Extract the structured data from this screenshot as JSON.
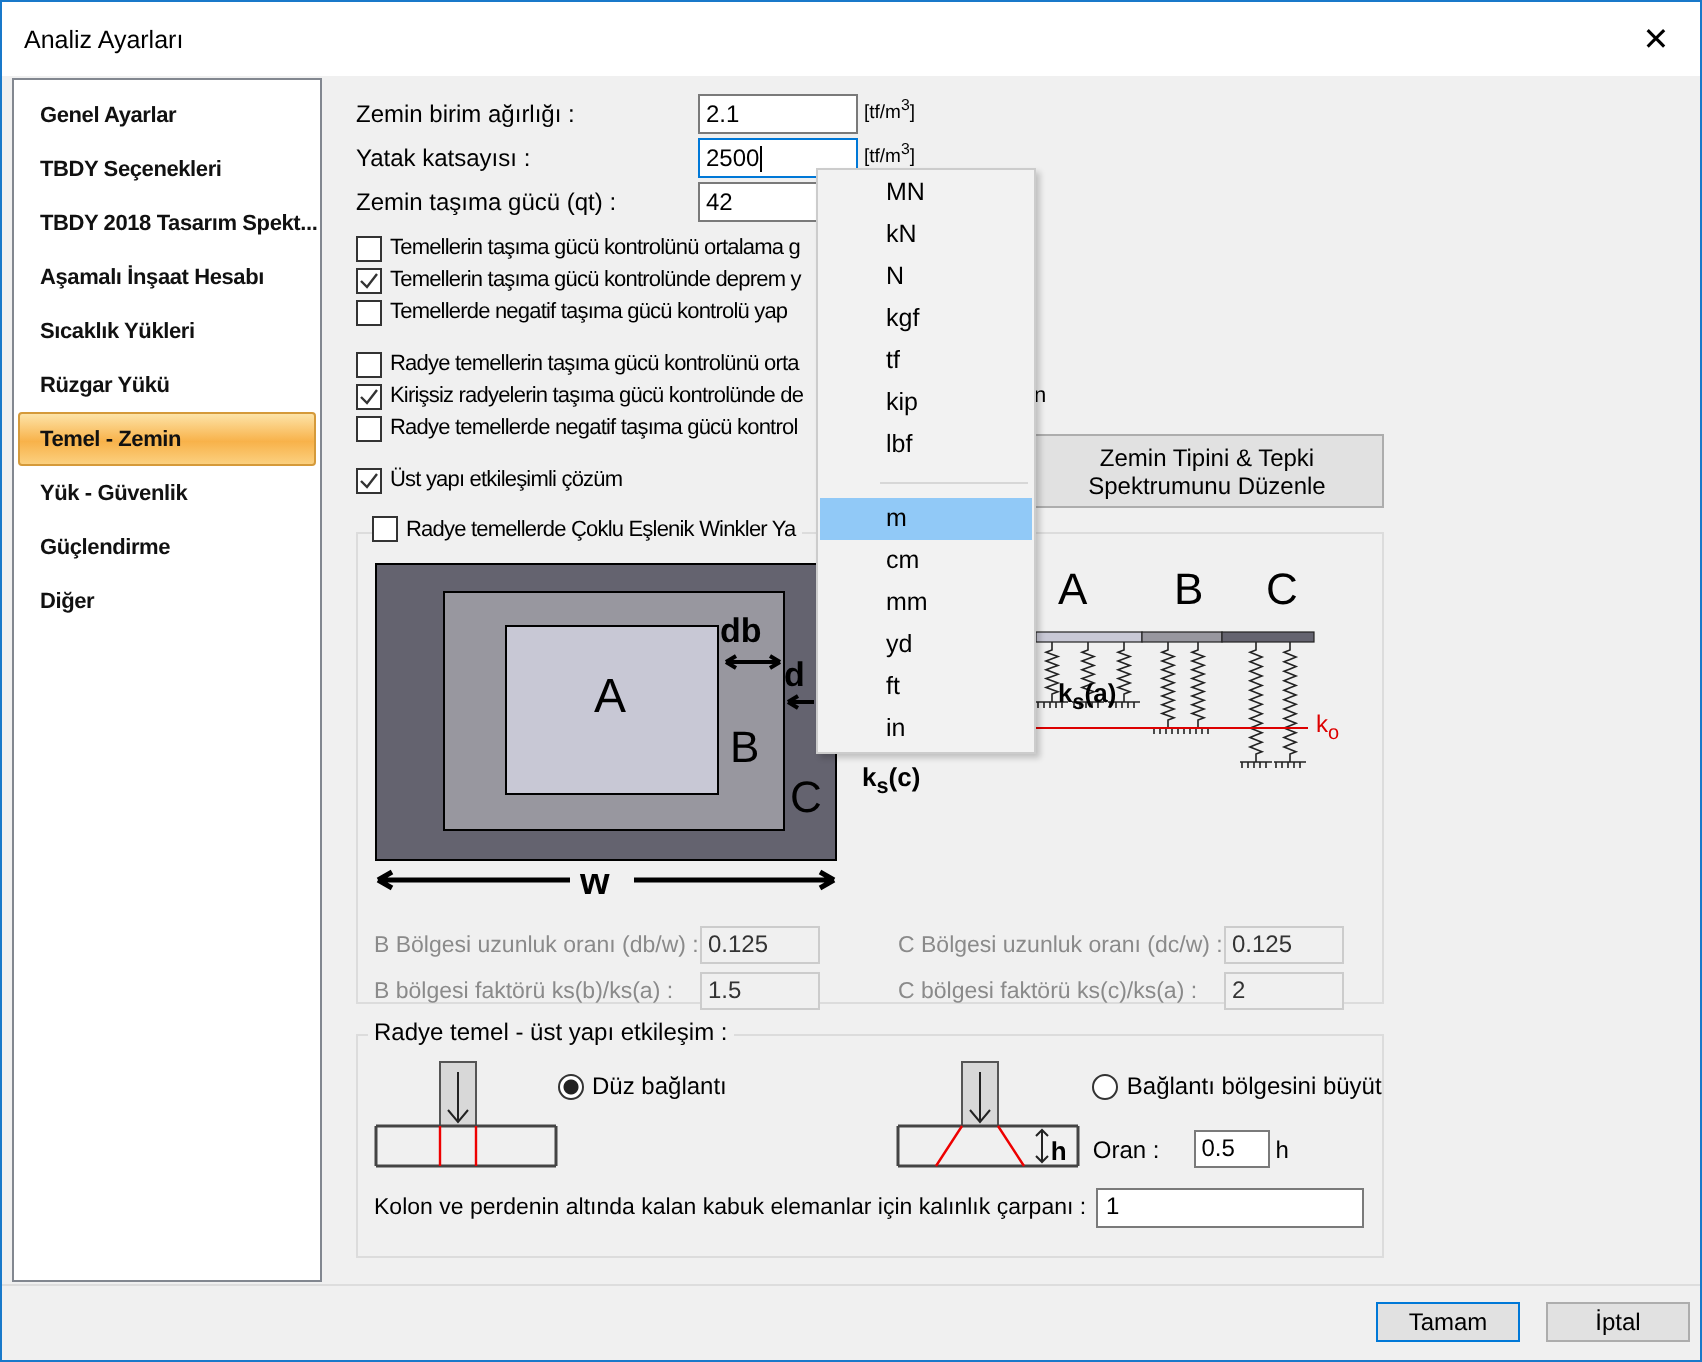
{
  "window": {
    "title": "Analiz Ayarları",
    "close": "✕"
  },
  "sidebar": {
    "items": [
      {
        "label": "Genel Ayarlar",
        "selected": false
      },
      {
        "label": "TBDY Seçenekleri",
        "selected": false
      },
      {
        "label": "TBDY 2018 Tasarım Spekt...",
        "selected": false
      },
      {
        "label": "Aşamalı İnşaat Hesabı",
        "selected": false
      },
      {
        "label": "Sıcaklık Yükleri",
        "selected": false
      },
      {
        "label": "Rüzgar Yükü",
        "selected": false
      },
      {
        "label": "Temel - Zemin",
        "selected": true
      },
      {
        "label": "Yük - Güvenlik",
        "selected": false
      },
      {
        "label": "Güçlendirme",
        "selected": false
      },
      {
        "label": "Diğer",
        "selected": false
      }
    ]
  },
  "fields": [
    {
      "label": "Zemin birim ağırlığı :",
      "value": "2.1",
      "unit": "[tf/m$^{3}$]",
      "focused": false
    },
    {
      "label": "Yatak katsayısı :",
      "value": "2500",
      "unit": "[tf/m$^{3}$]",
      "focused": true
    },
    {
      "label": "Zemin taşıma gücü (qt) :",
      "value": "42",
      "focused": false
    }
  ],
  "checkbox_groups": [
    [
      {
        "label": "Temellerin taşıma gücü kontrolünü ortalama g",
        "checked": false
      },
      {
        "label": "Temellerin taşıma gücü kontrolünde deprem y",
        "checked": true
      },
      {
        "label": "Temellerde negatif taşıma gücü kontrolü yap",
        "checked": false
      }
    ],
    [
      {
        "label": "Radye temellerin taşıma gücü kontrolünü orta",
        "checked": false
      },
      {
        "label": "Kirişsiz radyelerin taşıma gücü kontrolünde de",
        "tail": "n",
        "checked": true
      },
      {
        "label": "Radye temellerde negatif taşıma gücü kontrol",
        "checked": false
      }
    ],
    [
      {
        "label": "Üst yapı etkileşimli çözüm",
        "checked": true
      }
    ]
  ],
  "spectrum_button": "Zemin Tipini  & Tepki Spektrumunu Düzenle",
  "winkler": {
    "label": "Radye temellerde Çoklu Eşlenik Winkler Ya",
    "checked": false,
    "plan_labels": {
      "a": "A",
      "b": "B",
      "c": "C",
      "db": "db",
      "dc": "d",
      "w": "w"
    },
    "spring_labels": {
      "a": "A",
      "b": "B",
      "c": "C",
      "ksa": "k$_{s}$(a)",
      "ko": "k$_{o}$",
      "ksc": "k$_{s}$(c)"
    },
    "fields": [
      {
        "label": "B Bölgesi uzunluk oranı (db/w) :",
        "value": "0.125",
        "disabled": true
      },
      {
        "label": "C Bölgesi uzunluk oranı (dc/w) :",
        "value": "0.125",
        "disabled": true
      },
      {
        "label": "B bölgesi faktörü ks(b)/ks(a) :",
        "value": "1.5",
        "disabled": true
      },
      {
        "label": "C bölgesi faktörü ks(c)/ks(a) :",
        "value": "2",
        "disabled": true
      }
    ]
  },
  "interaction": {
    "legend": "Radye temel - üst yapı etkileşim :",
    "options": [
      {
        "label": "Düz bağlantı",
        "selected": true
      },
      {
        "label": "Bağlantı bölgesini büyüt",
        "selected": false
      }
    ],
    "h_label": "h",
    "ratio_label": "Oran :",
    "ratio_value": "0.5",
    "ratio_unit": "h",
    "thickness_label": "Kolon ve perdenin altında kalan kabuk elemanlar için kalınlık çarpanı :",
    "thickness_value": "1"
  },
  "unit_menu": {
    "items": [
      {
        "kind": "item",
        "label": "MN",
        "selected": false
      },
      {
        "kind": "item",
        "label": "kN",
        "selected": false
      },
      {
        "kind": "item",
        "label": "N",
        "selected": false
      },
      {
        "kind": "item",
        "label": "kgf",
        "selected": false
      },
      {
        "kind": "item",
        "label": "tf",
        "selected": false
      },
      {
        "kind": "item",
        "label": "kip",
        "selected": false
      },
      {
        "kind": "item",
        "label": "lbf",
        "selected": false
      },
      {
        "kind": "separator"
      },
      {
        "kind": "item",
        "label": "m",
        "selected": true
      },
      {
        "kind": "item",
        "label": "cm",
        "selected": false
      },
      {
        "kind": "item",
        "label": "mm",
        "selected": false
      },
      {
        "kind": "item",
        "label": "yd",
        "selected": false
      },
      {
        "kind": "item",
        "label": "ft",
        "selected": false
      },
      {
        "kind": "item",
        "label": "in",
        "selected": false
      }
    ]
  },
  "buttons": [
    "Tamam",
    "İptal"
  ]
}
